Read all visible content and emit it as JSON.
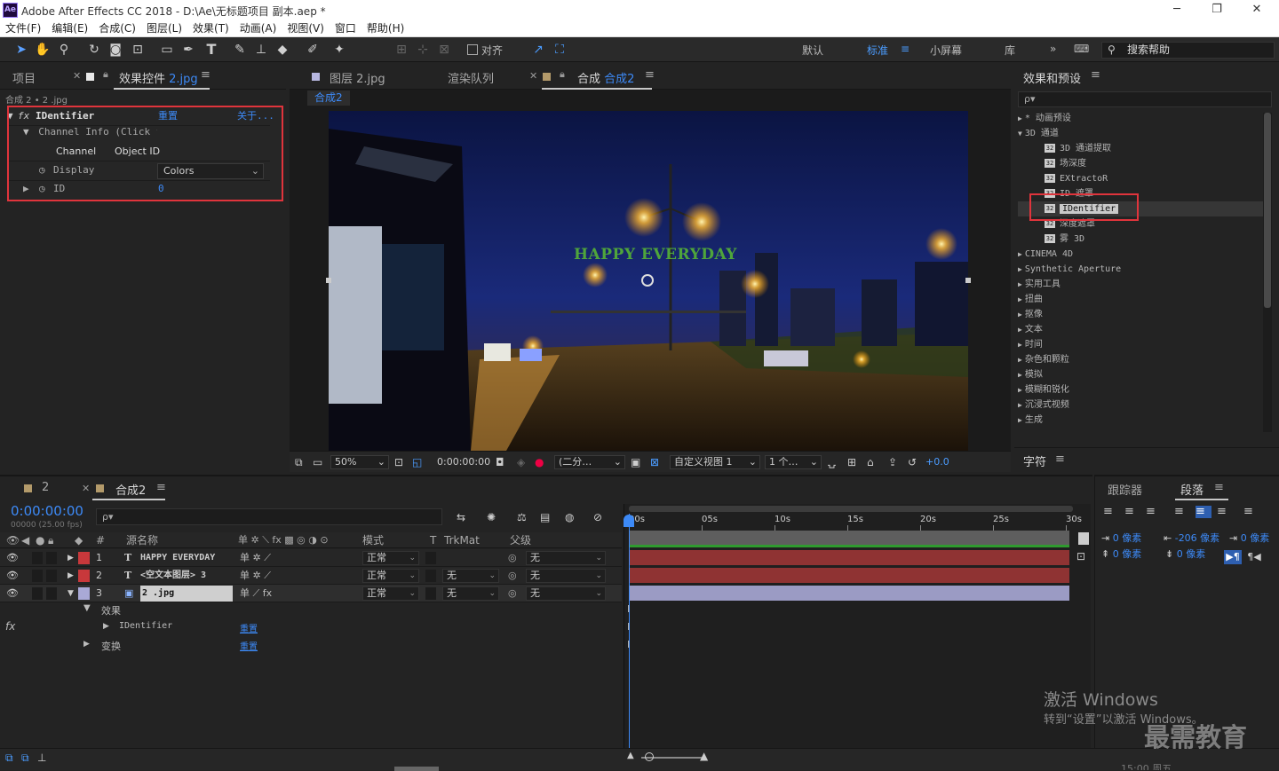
{
  "app": {
    "title": "Adobe After Effects CC 2018 - D:\\Ae\\无标题项目 副本.aep *",
    "logo": "Ae"
  },
  "menu": [
    "文件(F)",
    "编辑(E)",
    "合成(C)",
    "图层(L)",
    "效果(T)",
    "动画(A)",
    "视图(V)",
    "窗口",
    "帮助(H)"
  ],
  "toolbar": {
    "align_label": "对齐",
    "workspaces": [
      "默认",
      "标准",
      "小屏幕",
      "库"
    ],
    "active_workspace": "标准",
    "search_help": "搜索帮助"
  },
  "left_panel": {
    "tab_project": "项目",
    "tab_effects_prefix": "效果控件",
    "tab_effects_name": "2.jpg",
    "breadcrumb": "合成 2 • 2 .jpg",
    "effect": {
      "name": "IDentifier",
      "reset": "重置",
      "about": "关于...",
      "channel_info": "Channel Info (Click for",
      "channel_label": "Channel",
      "channel_value": "Object ID",
      "display_label": "Display",
      "display_value": "Colors",
      "id_label": "ID",
      "id_value": "0"
    }
  },
  "center_panel": {
    "tab_layer": "图层 2.jpg",
    "tab_render": "渲染队列",
    "tab_comp_prefix": "合成",
    "tab_comp_name": "合成2",
    "subtab": "合成2",
    "overlay_text": "HAPPY EVERYDAY",
    "viewer_bar": {
      "zoom": "50%",
      "timecode": "0:00:00:00",
      "resolution": "(二分…",
      "view": "自定义视图 1",
      "views": "1 个…",
      "exposure": "+0.0"
    }
  },
  "right_panel": {
    "title": "效果和预设",
    "search_placeholder": "ρ▾",
    "items": [
      {
        "label": "* 动画预设",
        "level": 0,
        "type": "folder-closed"
      },
      {
        "label": "3D 通道",
        "level": 0,
        "type": "folder-open"
      },
      {
        "label": "3D 通道提取",
        "level": 1,
        "type": "effect"
      },
      {
        "label": "场深度",
        "level": 1,
        "type": "effect"
      },
      {
        "label": "EXtractoR",
        "level": 1,
        "type": "effect"
      },
      {
        "label": "ID 遮罩",
        "level": 1,
        "type": "effect"
      },
      {
        "label": "IDentifier",
        "level": 1,
        "type": "effect",
        "selected": true
      },
      {
        "label": "深度遮罩",
        "level": 1,
        "type": "effect"
      },
      {
        "label": "雾 3D",
        "level": 1,
        "type": "effect"
      },
      {
        "label": "CINEMA 4D",
        "level": 0,
        "type": "folder-closed"
      },
      {
        "label": "Synthetic Aperture",
        "level": 0,
        "type": "folder-closed"
      },
      {
        "label": "实用工具",
        "level": 0,
        "type": "folder-closed"
      },
      {
        "label": "扭曲",
        "level": 0,
        "type": "folder-closed"
      },
      {
        "label": "抠像",
        "level": 0,
        "type": "folder-closed"
      },
      {
        "label": "文本",
        "level": 0,
        "type": "folder-closed"
      },
      {
        "label": "时间",
        "level": 0,
        "type": "folder-closed"
      },
      {
        "label": "杂色和颗粒",
        "level": 0,
        "type": "folder-closed"
      },
      {
        "label": "模拟",
        "level": 0,
        "type": "folder-closed"
      },
      {
        "label": "模糊和锐化",
        "level": 0,
        "type": "folder-closed"
      },
      {
        "label": "沉浸式视频",
        "level": 0,
        "type": "folder-closed"
      },
      {
        "label": "生成",
        "level": 0,
        "type": "folder-closed"
      }
    ],
    "character_title": "字符",
    "tracker_title": "跟踪器",
    "paragraph_title": "段落",
    "indent_values": [
      "0 像素",
      "-206 像素",
      "0 像素",
      "0 像素",
      "0 像素"
    ]
  },
  "timeline": {
    "tab_render": "2",
    "tab_comp": "合成2",
    "timecode": "0:00:00:00",
    "fps": "00000 (25.00 fps)",
    "columns": {
      "name": "源名称",
      "mode": "模式",
      "t": "T",
      "trkmat": "TrkMat",
      "parent": "父级"
    },
    "ruler": [
      "00s",
      "05s",
      "10s",
      "15s",
      "20s",
      "25s",
      "30s"
    ],
    "layers": [
      {
        "num": "1",
        "type": "T",
        "name": "HAPPY EVERYDAY",
        "mode": "正常",
        "trkmat": "",
        "parent": "无",
        "color": "#c8383b"
      },
      {
        "num": "2",
        "type": "T",
        "name": "<空文本图层> 3",
        "mode": "正常",
        "trkmat": "无",
        "parent": "无",
        "color": "#c8383b"
      },
      {
        "num": "3",
        "type": "img",
        "name": "2 .jpg",
        "mode": "正常",
        "trkmat": "无",
        "parent": "无",
        "color": "#a9a9d6"
      }
    ],
    "sub_effects": "效果",
    "sub_identifier": "IDentifier",
    "sub_reset": "重置",
    "sub_transform": "变换",
    "sub_transform_reset": "重置"
  },
  "watermark": {
    "line1": "激活 Windows",
    "line2": "转到“设置”以激活 Windows。",
    "brand": "最需教育",
    "clock": "15:00 周五"
  }
}
